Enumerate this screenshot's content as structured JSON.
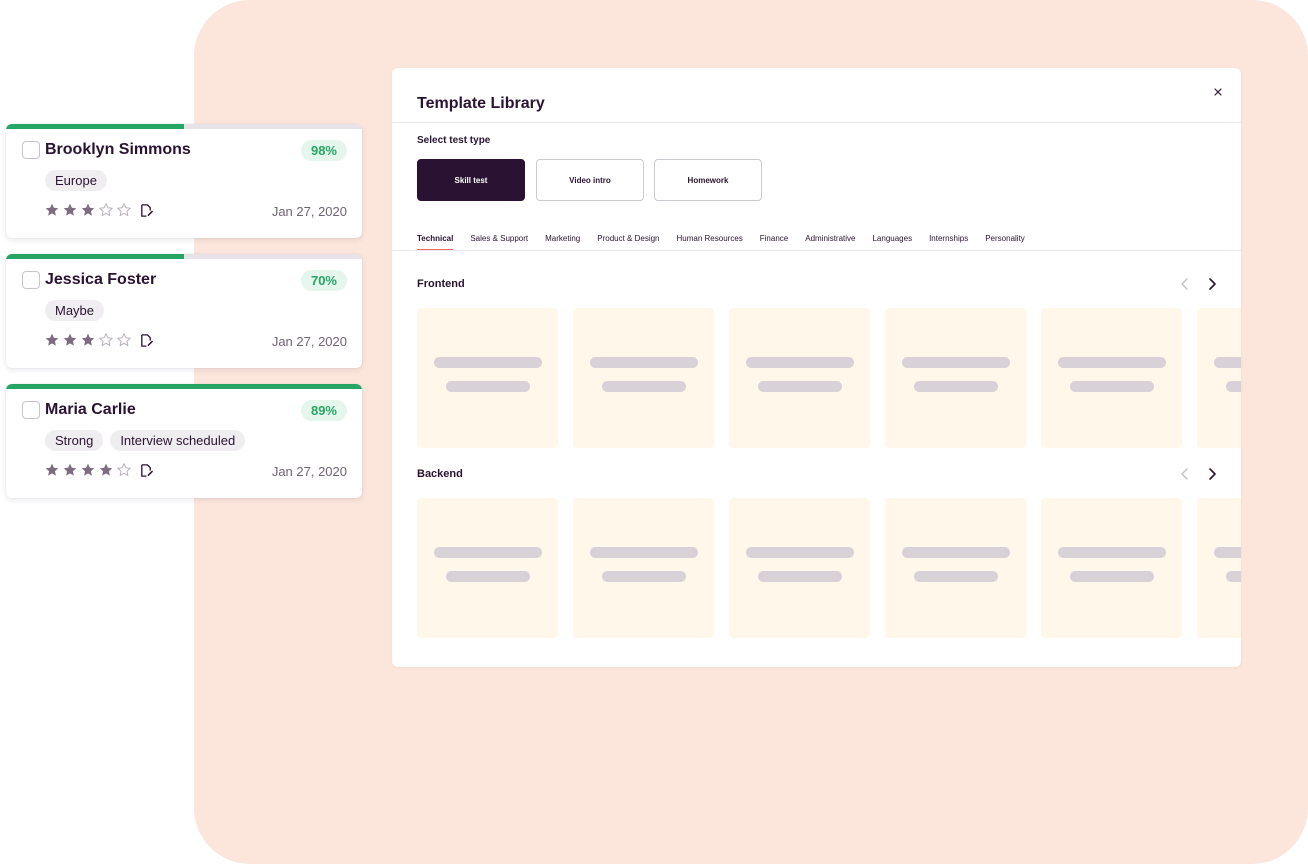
{
  "candidates": [
    {
      "name": "Brooklyn Simmons",
      "score": "98%",
      "progress": 0.5,
      "tags": [
        "Europe"
      ],
      "rating": 3,
      "max_rating": 5,
      "date": "Jan 27, 2020"
    },
    {
      "name": "Jessica Foster",
      "score": "70%",
      "progress": 0.5,
      "tags": [
        "Maybe"
      ],
      "rating": 3,
      "max_rating": 5,
      "date": "Jan 27, 2020"
    },
    {
      "name": "Maria Carlie",
      "score": "89%",
      "progress": 1.0,
      "tags": [
        "Strong",
        "Interview scheduled"
      ],
      "rating": 4,
      "max_rating": 5,
      "date": "Jan 27, 2020"
    }
  ],
  "modal": {
    "title": "Template Library",
    "select_label": "Select test type",
    "test_types": [
      {
        "label": "Skill test",
        "active": true
      },
      {
        "label": "Video intro",
        "active": false
      },
      {
        "label": "Homework",
        "active": false
      }
    ],
    "categories": [
      {
        "label": "Technical",
        "active": true
      },
      {
        "label": "Sales & Support",
        "active": false
      },
      {
        "label": "Marketing",
        "active": false
      },
      {
        "label": "Product & Design",
        "active": false
      },
      {
        "label": "Human Resources",
        "active": false
      },
      {
        "label": "Finance",
        "active": false
      },
      {
        "label": "Administrative",
        "active": false
      },
      {
        "label": "Languages",
        "active": false
      },
      {
        "label": "Internships",
        "active": false
      },
      {
        "label": "Personality",
        "active": false
      }
    ],
    "sections": [
      {
        "title": "Frontend"
      },
      {
        "title": "Backend"
      }
    ]
  },
  "icons": {
    "close": "close-icon",
    "prev": "chevron-left-icon",
    "next": "chevron-right-icon",
    "star": "star-icon",
    "note": "note-edit-icon"
  },
  "colors": {
    "brand_dark": "#2a1332",
    "success": "#27a565",
    "success_bg": "#e5f6ec",
    "tab_underline": "#f26a6a",
    "background_panel": "#fce6dc",
    "tile_bg": "#fff7e9",
    "star_filled": "#7d6b80",
    "star_empty": "#b9b0bc"
  }
}
